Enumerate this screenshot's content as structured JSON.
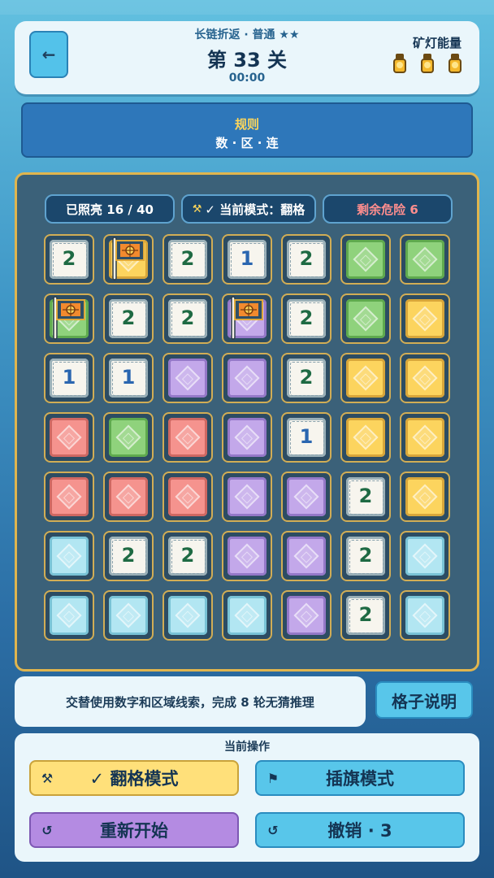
{
  "header": {
    "subtitle": "长链折返 · 普通 ★★",
    "title": "第 33 关",
    "timer": "00:00",
    "energy_label": "矿灯能量",
    "energy_count": 3
  },
  "rules": {
    "title": "规则",
    "text": "数 · 区 · 连"
  },
  "stats": {
    "lit": "已照亮 16 / 40",
    "mode": "✓ 当前模式：翻格",
    "danger": "剩余危险 6"
  },
  "board": [
    [
      "2",
      "flag-yellow",
      "2",
      "1",
      "2",
      "green",
      "green"
    ],
    [
      "flag-green",
      "2",
      "2",
      "flag-purple",
      "2",
      "green",
      "yellow"
    ],
    [
      "1",
      "1",
      "purple",
      "purple",
      "2",
      "yellow",
      "yellow"
    ],
    [
      "red",
      "green",
      "red",
      "purple",
      "1",
      "yellow",
      "yellow"
    ],
    [
      "red",
      "red",
      "red",
      "purple",
      "purple",
      "2",
      "yellow"
    ],
    [
      "cyan",
      "2",
      "2",
      "purple",
      "purple",
      "2",
      "cyan"
    ],
    [
      "cyan",
      "cyan",
      "cyan",
      "cyan",
      "purple",
      "2",
      "cyan"
    ]
  ],
  "hint": "交替使用数字和区域线索，完成 8 轮无猜推理",
  "cell_help_label": "格子说明",
  "ops": {
    "title": "当前操作",
    "flip_label": "✓ 翻格模式",
    "flag_label": "插旗模式",
    "restart_label": "重新开始",
    "undo_label": "撤销 · 3"
  },
  "colors": {
    "green": "#8fd27c",
    "yellow": "#fcd45e",
    "purple": "#c3a8ea",
    "red": "#f5938e",
    "cyan": "#b2e6f2",
    "board_border": "#e0b54e"
  }
}
